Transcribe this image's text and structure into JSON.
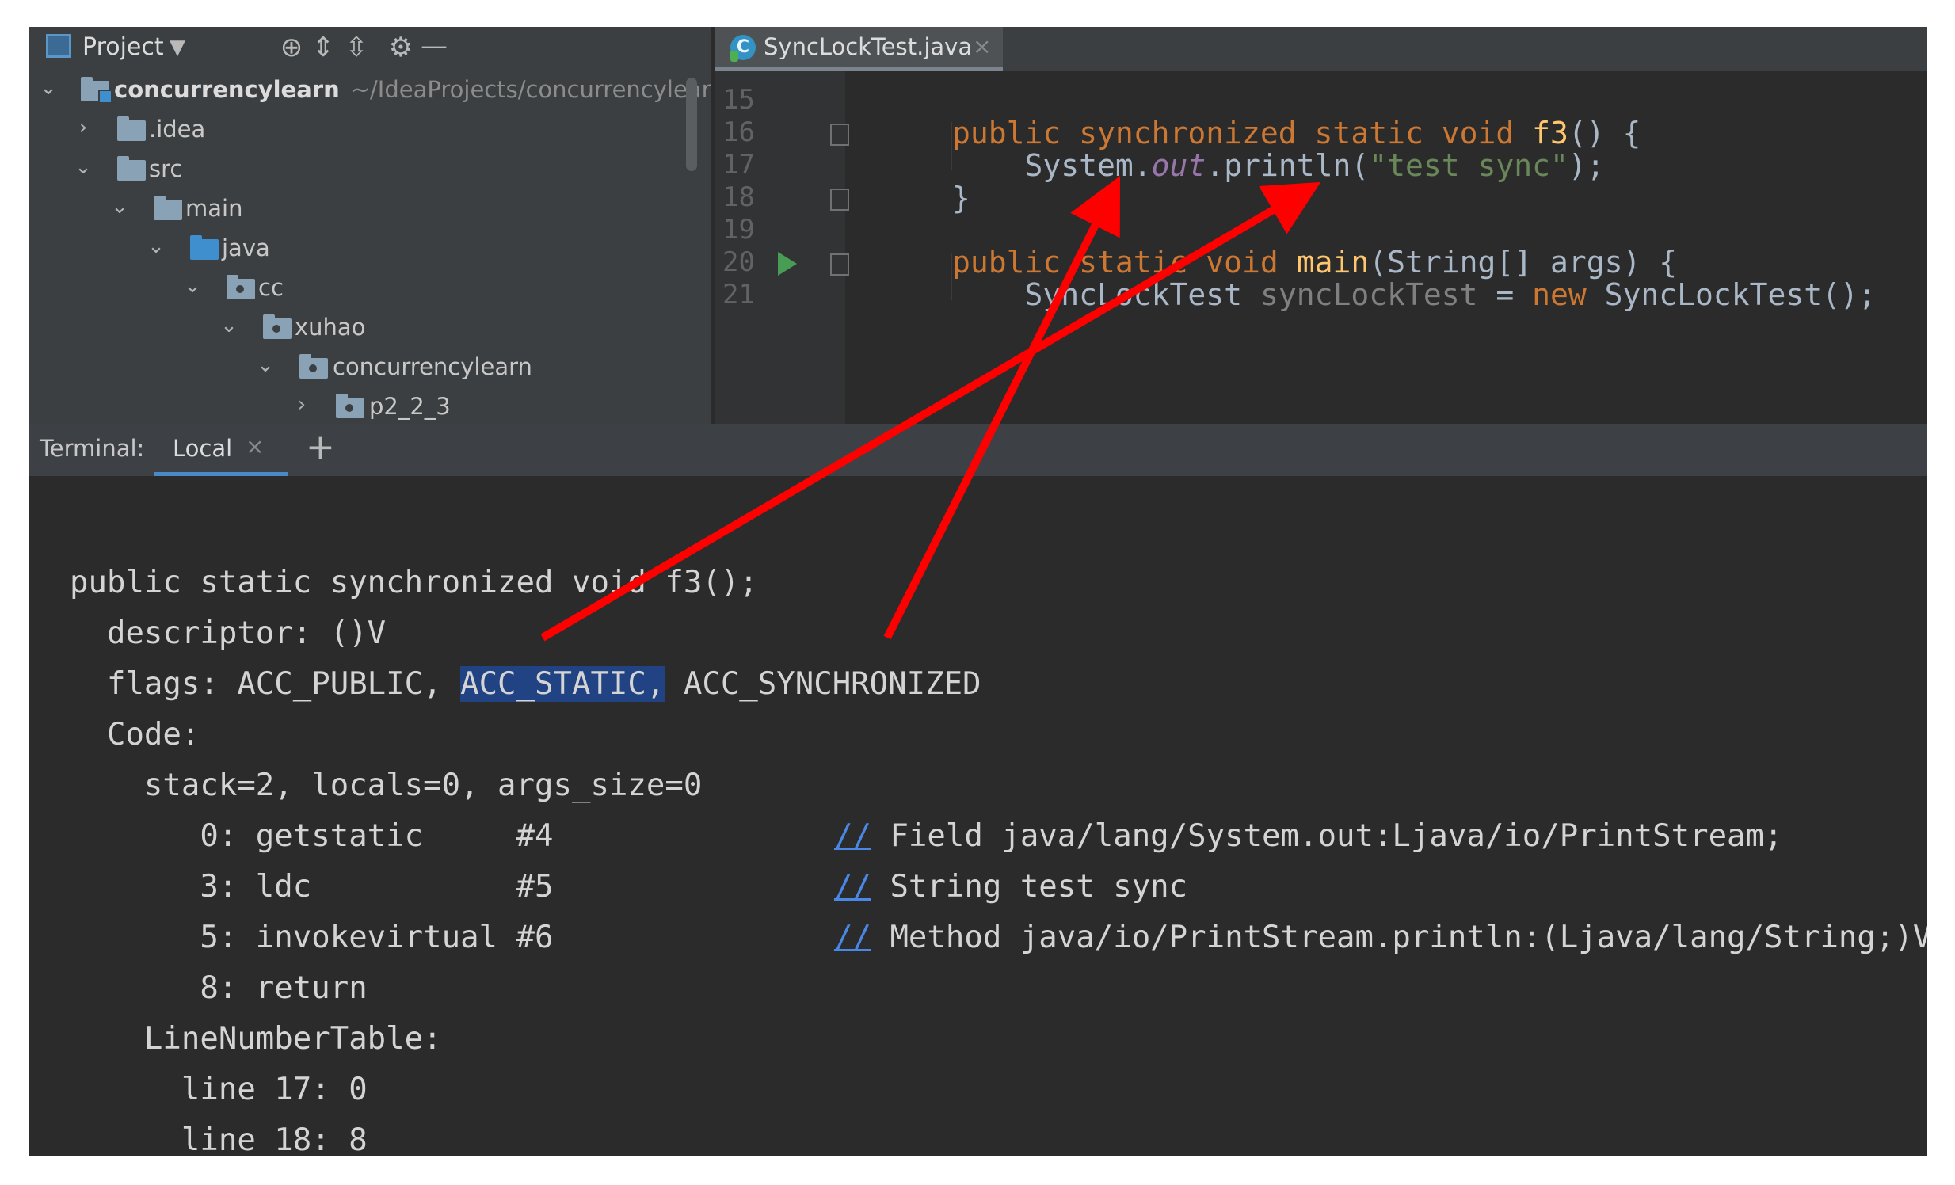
{
  "project": {
    "title": "Project",
    "tree": [
      {
        "label": "concurrencylearn",
        "path": "~/IdeaProjects/concurrencylearn"
      },
      {
        "label": ".idea"
      },
      {
        "label": "src"
      },
      {
        "label": "main"
      },
      {
        "label": "java"
      },
      {
        "label": "cc"
      },
      {
        "label": "xuhao"
      },
      {
        "label": "concurrencylearn"
      },
      {
        "label": "p2_2_3"
      }
    ]
  },
  "editor": {
    "tab": {
      "label": "SyncLockTest.java",
      "icon": "C"
    },
    "lines": [
      "15",
      "16",
      "17",
      "18",
      "19",
      "20",
      "21"
    ],
    "code": {
      "l16": {
        "kw1": "public synchronized static void ",
        "fn": "f3",
        "rest": "() {"
      },
      "l17": {
        "a": "System.",
        "field": "out",
        "b": ".println(",
        "str": "\"test sync\"",
        "c": ");"
      },
      "l18": "}",
      "l20": {
        "kw1": "public static void ",
        "fn": "main",
        "rest": "(String[] args) {"
      },
      "l21": {
        "a": "SyncLockTest ",
        "var": "syncLockTest",
        "b": " = ",
        "kw": "new",
        "c": " SyncLockTest();"
      }
    }
  },
  "terminal": {
    "title": "Terminal:",
    "tab": "Local",
    "lines": {
      "sig": "public static synchronized void f3();",
      "descriptor": "  descriptor: ()V",
      "flags_pre": "  flags: ACC_PUBLIC, ",
      "flags_sel": "ACC_STATIC,",
      "flags_post": " ACC_SYNCHRONIZED",
      "code": "  Code:",
      "stack": "    stack=2, locals=0, args_size=0",
      "i0": "       0: getstatic     #4",
      "i3": "       3: ldc           #5",
      "i5": "       5: invokevirtual #6",
      "i8": "       8: return",
      "lnt": "    LineNumberTable:",
      "ln17": "      line 17: 0",
      "ln18": "      line 18: 8",
      "c0": "Field java/lang/System.out:Ljava/io/PrintStream;",
      "c3": "String test sync",
      "c5": "Method java/io/PrintStream.println:(Ljava/lang/String;)V",
      "slashes": "//"
    }
  },
  "annotation": {
    "arrow_color": "#ff0000"
  }
}
